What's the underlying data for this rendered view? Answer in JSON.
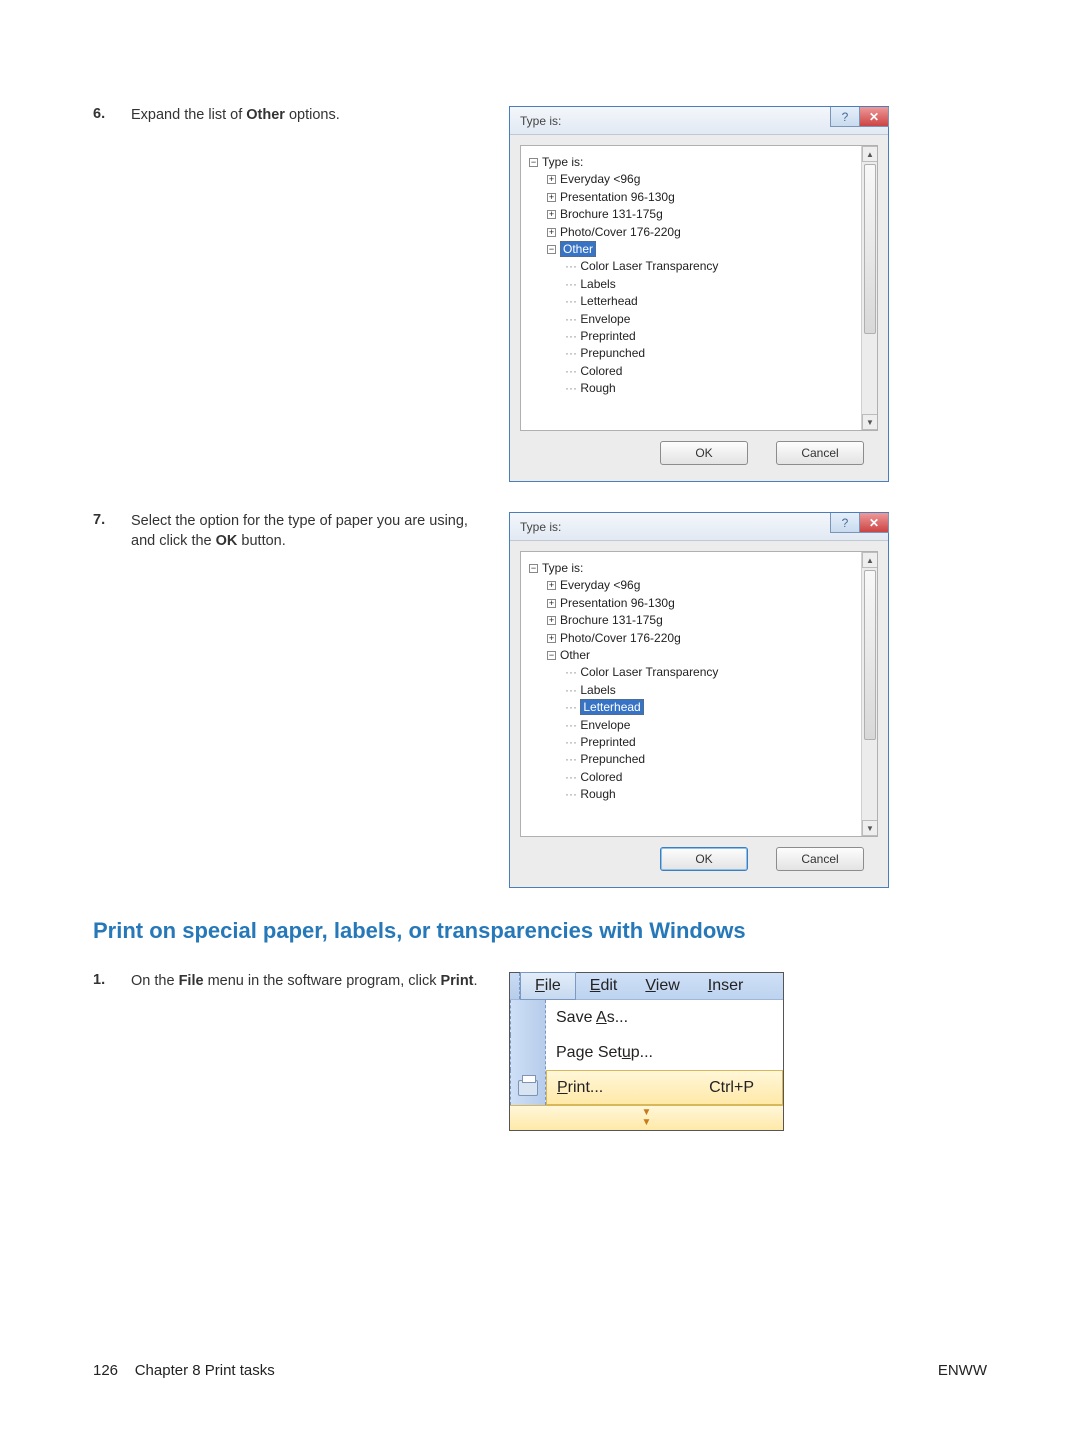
{
  "steps": {
    "s6": {
      "num": "6.",
      "text_a": "Expand the list of ",
      "bold": "Other",
      "text_b": " options."
    },
    "s7": {
      "num": "7.",
      "text_a": "Select the option for the type of paper you are using, and click the ",
      "bold": "OK",
      "text_b": " button."
    },
    "s1": {
      "num": "1.",
      "text_a": "On the ",
      "bold1": "File",
      "text_b": " menu in the software program, click ",
      "bold2": "Print",
      "text_c": "."
    }
  },
  "heading": "Print on special paper, labels, or transparencies with Windows",
  "dialog": {
    "title": "Type is:",
    "ok": "OK",
    "cancel": "Cancel",
    "tree": {
      "root": "Type is:",
      "everday": "Everyday <96g",
      "presentation": "Presentation 96-130g",
      "brochure": "Brochure 131-175g",
      "photo": "Photo/Cover 176-220g",
      "other": "Other",
      "clt": "Color Laser Transparency",
      "labels": "Labels",
      "letterhead": "Letterhead",
      "envelope": "Envelope",
      "preprinted": "Preprinted",
      "prepunched": "Prepunched",
      "colored": "Colored",
      "rough": "Rough"
    }
  },
  "menu": {
    "file": "File",
    "edit": "Edit",
    "view": "View",
    "inser": "Inser",
    "save_as": "Save As...",
    "page_setup": "Page Setup...",
    "print": "Print...",
    "shortcut": "Ctrl+P"
  },
  "footer": {
    "page": "126",
    "chapter": "Chapter 8   Print tasks",
    "right": "ENWW"
  }
}
